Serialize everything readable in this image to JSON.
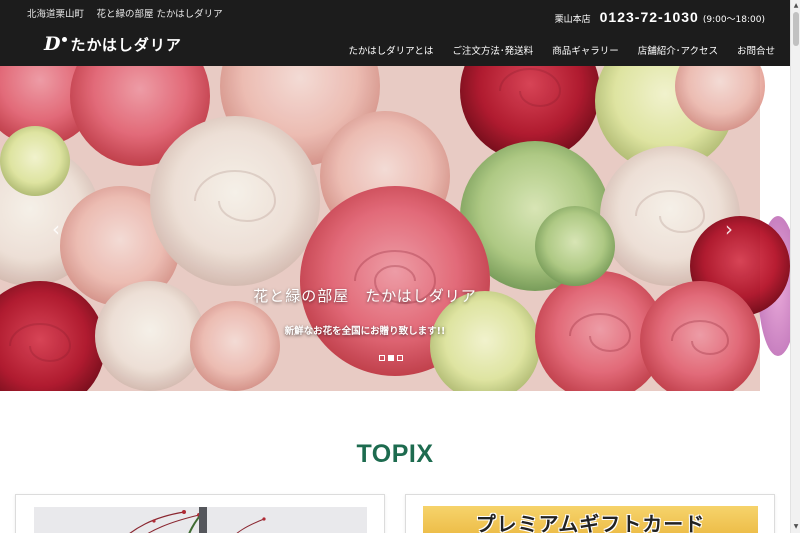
{
  "header": {
    "tagline": "北海道栗山町　 花と緑の部屋 たかはしダリア",
    "contact": {
      "shop": "栗山本店",
      "tel": "0123-72-1030",
      "hours": "(9:00〜18:00)"
    },
    "logo": {
      "mark": "D",
      "text": "たかはしダリア"
    },
    "nav": [
      "たかはしダリアとは",
      "ご注文方法･発送料",
      "商品ギャラリー",
      "店舗紹介･アクセス",
      "お問合せ"
    ]
  },
  "hero": {
    "title": "花と緑の部屋　たかはしダリア",
    "subtitle": "新鮮なお花を全国にお贈り致します!!",
    "prev_icon": "‹",
    "next_icon": "›",
    "slide_count": 3,
    "active_slide": 2
  },
  "topix": {
    "title": "TOPIX",
    "cards": [
      {
        "image": "flower-arrangement-photo"
      },
      {
        "image": "premium-gift-card-banner",
        "banner_text": "プレミアムギフトカード"
      }
    ]
  },
  "colors": {
    "header_bg": "#1c1c1c",
    "accent_green": "#1d6b4f",
    "banner_gold": "#f0c24f"
  }
}
